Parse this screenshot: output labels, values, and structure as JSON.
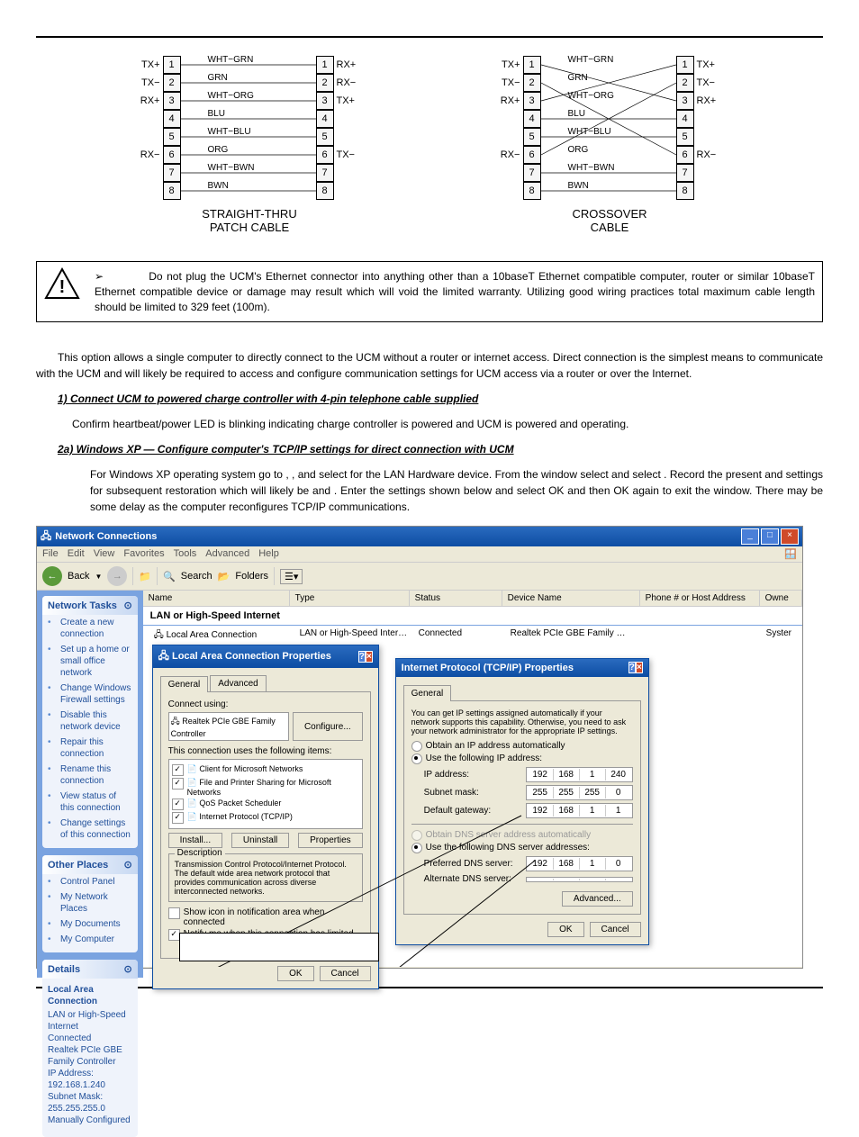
{
  "diagram1": {
    "title": "STRAIGHT-THRU\nPATCH CABLE",
    "left_labels": [
      "TX+",
      "TX−",
      "RX+",
      "",
      "",
      "RX−",
      "",
      ""
    ],
    "right_labels": [
      "RX+",
      "RX−",
      "TX+",
      "",
      "",
      "TX−",
      "",
      ""
    ],
    "wires": [
      "WHT−GRN",
      "GRN",
      "WHT−ORG",
      "BLU",
      "WHT−BLU",
      "ORG",
      "WHT−BWN",
      "BWN"
    ]
  },
  "diagram2": {
    "title": "CROSSOVER\nCABLE",
    "left_labels": [
      "TX+",
      "TX−",
      "RX+",
      "",
      "",
      "RX−",
      "",
      ""
    ],
    "right_labels": [
      "TX+",
      "TX−",
      "RX+",
      "",
      "",
      "RX−",
      "",
      ""
    ],
    "wires": [
      "WHT−GRN",
      "GRN",
      "WHT−ORG",
      "BLU",
      "WHT−BLU",
      "ORG",
      "WHT−BWN",
      "BWN"
    ]
  },
  "warning": "Do not plug the UCM's Ethernet connector into anything other than a 10baseT Ethernet compatible computer, router or similar 10baseT Ethernet compatible device or damage may result which will void the limited warranty. Utilizing good wiring practices total maximum cable length should be limited to 329 feet (100m).",
  "intro": "This option allows a single computer to directly connect to the UCM without a router or internet access. Direct connection is the simplest means to communicate with the UCM and will likely be required to access and configure communication settings for UCM access via a router or over the Internet.",
  "step1_head": "1)  Connect UCM to powered charge controller with 4-pin telephone cable supplied",
  "step1_body": "Confirm heartbeat/power LED is blinking indicating charge controller is powered and UCM is powered and operating.",
  "step2_head": "2a)  Windows XP  —   Configure computer's TCP/IP settings for direct connection with UCM",
  "step2_body": "For Windows XP operating system go to                          ,                                              , and select                        for the LAN Hardware device. From the                                          window select                                                   and select                     . Record the present                                              and                      settings for subsequent restoration which will likely be                                                                         and                                                          . Enter the                                                           settings shown below and select OK and then OK again to exit the                                          window. There may be some delay as the computer reconfigures TCP/IP communications.",
  "win": {
    "title": "Network Connections",
    "menu": [
      "File",
      "Edit",
      "View",
      "Favorites",
      "Tools",
      "Advanced",
      "Help"
    ],
    "back": "Back",
    "search": "Search",
    "folders": "Folders",
    "cols": {
      "name": "Name",
      "type": "Type",
      "status": "Status",
      "device": "Device Name",
      "phone": "Phone # or Host Address",
      "owner": "Owne"
    },
    "group": "LAN or High-Speed Internet",
    "row": {
      "name": "Local Area Connection",
      "type": "LAN or High-Speed Inter…",
      "status": "Connected",
      "device": "Realtek PCIe GBE Family …",
      "owner": "Syster"
    },
    "tasks_head": "Network Tasks",
    "tasks": [
      "Create a new connection",
      "Set up a home or small office network",
      "Change Windows Firewall settings",
      "Disable this network device",
      "Repair this connection",
      "Rename this connection",
      "View status of this connection",
      "Change settings of this connection"
    ],
    "other_head": "Other Places",
    "other": [
      "Control Panel",
      "My Network Places",
      "My Documents",
      "My Computer"
    ],
    "details_head": "Details",
    "details": {
      "title": "Local Area Connection",
      "l1": "LAN or High-Speed Internet",
      "l2": "Connected",
      "l3": "Realtek PCIe GBE Family Controller",
      "l4": "IP Address: 192.168.1.240",
      "l5": "Subnet Mask: 255.255.255.0",
      "l6": "Manually Configured"
    }
  },
  "dlg1": {
    "title": "Local Area Connection Properties",
    "tab_general": "General",
    "tab_advanced": "Advanced",
    "connect_using": "Connect using:",
    "adapter": "Realtek PCIe GBE Family Controller",
    "configure": "Configure...",
    "uses": "This connection uses the following items:",
    "items": [
      "Client for Microsoft Networks",
      "File and Printer Sharing for Microsoft Networks",
      "QoS Packet Scheduler",
      "Internet Protocol (TCP/IP)"
    ],
    "install": "Install...",
    "uninstall": "Uninstall",
    "properties": "Properties",
    "desc_head": "Description",
    "desc": "Transmission Control Protocol/Internet Protocol. The default wide area network protocol that provides communication across diverse interconnected networks.",
    "chk1": "Show icon in notification area when connected",
    "chk2": "Notify me when this connection has limited or no connectivity",
    "ok": "OK",
    "cancel": "Cancel"
  },
  "dlg2": {
    "title": "Internet Protocol (TCP/IP) Properties",
    "tab_general": "General",
    "info": "You can get IP settings assigned automatically if your network supports this capability. Otherwise, you need to ask your network administrator for the appropriate IP settings.",
    "r1": "Obtain an IP address automatically",
    "r2": "Use the following IP address:",
    "ip_label": "IP address:",
    "ip": [
      "192",
      "168",
      "1",
      "240"
    ],
    "mask_label": "Subnet mask:",
    "mask": [
      "255",
      "255",
      "255",
      "0"
    ],
    "gw_label": "Default gateway:",
    "gw": [
      "192",
      "168",
      "1",
      "1"
    ],
    "r3": "Obtain DNS server address automatically",
    "r4": "Use the following DNS server addresses:",
    "dns1_label": "Preferred DNS server:",
    "dns1": [
      "192",
      "168",
      "1",
      "0"
    ],
    "dns2_label": "Alternate DNS server:",
    "dns2": [
      "",
      "",
      "",
      ""
    ],
    "advanced": "Advanced...",
    "ok": "OK",
    "cancel": "Cancel"
  }
}
